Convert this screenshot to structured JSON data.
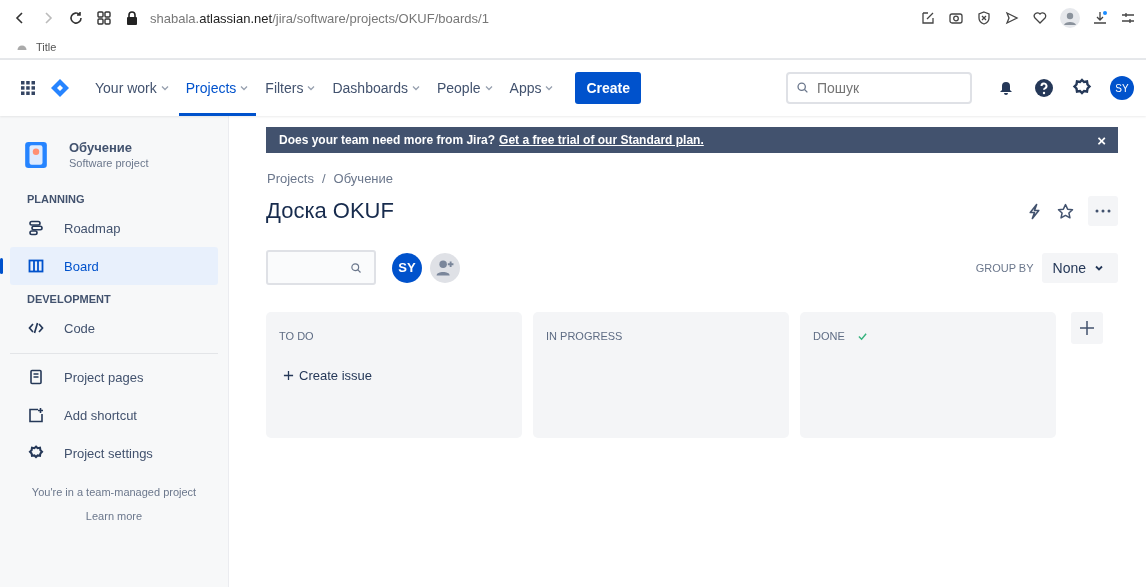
{
  "browser": {
    "url_host_pre": "shabala.",
    "url_host": "atlassian.net",
    "url_path": "/jira/software/projects/OKUF/boards/1",
    "bookmark": "Title"
  },
  "nav": {
    "items": [
      {
        "label": "Your work",
        "selected": false
      },
      {
        "label": "Projects",
        "selected": true
      },
      {
        "label": "Filters",
        "selected": false
      },
      {
        "label": "Dashboards",
        "selected": false
      },
      {
        "label": "People",
        "selected": false
      },
      {
        "label": "Apps",
        "selected": false
      }
    ],
    "create": "Create",
    "search": {
      "placeholder": "Пошук"
    },
    "avatar": "SY"
  },
  "sidebar": {
    "project": {
      "name": "Обучение",
      "type": "Software project"
    },
    "sections": [
      {
        "heading": "PLANNING",
        "items": [
          {
            "label": "Roadmap",
            "kind": "roadmap",
            "selected": false
          },
          {
            "label": "Board",
            "kind": "board",
            "selected": true
          }
        ]
      },
      {
        "heading": "DEVELOPMENT",
        "items": [
          {
            "label": "Code",
            "kind": "code",
            "selected": false
          }
        ]
      }
    ],
    "links": [
      {
        "label": "Project pages",
        "kind": "pages"
      },
      {
        "label": "Add shortcut",
        "kind": "shortcut"
      },
      {
        "label": "Project settings",
        "kind": "settings"
      }
    ],
    "footer": "You're in a team-managed project",
    "learn_more": "Learn more"
  },
  "banner": {
    "text": "Does your team need more from Jira?",
    "link": "Get a free trial of our Standard plan.",
    "close": "×"
  },
  "breadcrumbs": [
    "Projects",
    "Обучение"
  ],
  "breadcrumb_separator": "/",
  "title": "Доска OKUF",
  "toolbar": {
    "avatar": "SY",
    "group_by_label": "GROUP BY",
    "group_by_value": "None"
  },
  "columns": [
    {
      "title": "TO DO",
      "done": false,
      "create_label": "Create issue"
    },
    {
      "title": "IN PROGRESS",
      "done": false
    },
    {
      "title": "DONE",
      "done": true
    }
  ]
}
